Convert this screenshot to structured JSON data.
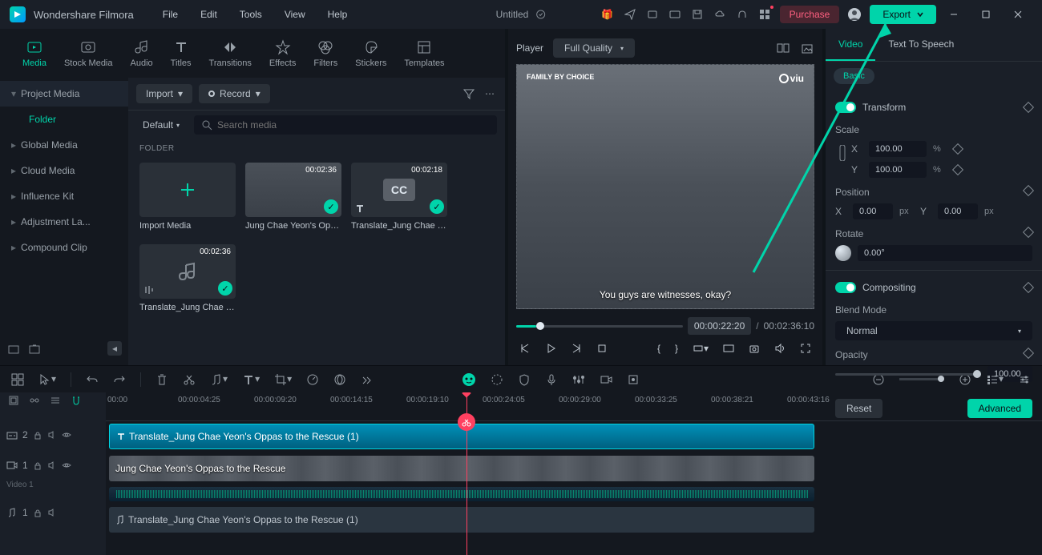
{
  "app": {
    "name": "Wondershare Filmora",
    "title": "Untitled"
  },
  "menu": [
    "File",
    "Edit",
    "Tools",
    "View",
    "Help"
  ],
  "titlebar": {
    "purchase": "Purchase",
    "export": "Export"
  },
  "modules": [
    "Media",
    "Stock Media",
    "Audio",
    "Titles",
    "Transitions",
    "Effects",
    "Filters",
    "Stickers",
    "Templates"
  ],
  "sidebar": {
    "project": "Project Media",
    "folder": "Folder",
    "items": [
      "Global Media",
      "Cloud Media",
      "Influence Kit",
      "Adjustment La...",
      "Compound Clip"
    ]
  },
  "lib": {
    "import": "Import",
    "record": "Record",
    "default": "Default",
    "search_ph": "Search media",
    "folder_hdr": "FOLDER",
    "thumbs": [
      {
        "label": "Import Media",
        "dur": "",
        "type": "add"
      },
      {
        "label": "Jung Chae Yeon's Opp...",
        "dur": "00:02:36",
        "type": "video"
      },
      {
        "label": "Translate_Jung Chae Y...",
        "dur": "00:02:18",
        "type": "cc"
      },
      {
        "label": "Translate_Jung Chae Y...",
        "dur": "00:02:36",
        "type": "audio"
      }
    ]
  },
  "player": {
    "label": "Player",
    "quality": "Full Quality",
    "subtitle": "You guys are witnesses, okay?",
    "brand_tag": "FAMILY BY CHOICE",
    "viu": "viu",
    "time_cur": "00:00:22:20",
    "time_tot": "00:02:36:10"
  },
  "props": {
    "tabs": [
      "Video",
      "Text To Speech"
    ],
    "basic": "Basic",
    "transform": "Transform",
    "scale": "Scale",
    "scale_x": "100.00",
    "scale_y": "100.00",
    "pct": "%",
    "position": "Position",
    "pos_x": "0.00",
    "pos_y": "0.00",
    "px": "px",
    "rotate": "Rotate",
    "rot_val": "0.00°",
    "compositing": "Compositing",
    "blend": "Blend Mode",
    "blend_val": "Normal",
    "opacity": "Opacity",
    "opacity_val": "100.00",
    "reset": "Reset",
    "advanced": "Advanced"
  },
  "timeline": {
    "ticks": [
      "00:00",
      "00:00:04:25",
      "00:00:09:20",
      "00:00:14:15",
      "00:00:19:10",
      "00:00:24:05",
      "00:00:29:00",
      "00:00:33:25",
      "00:00:38:21",
      "00:00:43:16"
    ],
    "tracks": {
      "t2_label": "2",
      "v1_label": "1",
      "v1_name": "Video 1",
      "a1_label": "1",
      "clip_sub": "Translate_Jung Chae Yeon's Oppas to the Rescue (1)",
      "clip_vid": "Jung Chae Yeon's Oppas to the Rescue",
      "clip_aud": "Translate_Jung Chae Yeon's Oppas to the Rescue (1)"
    }
  }
}
